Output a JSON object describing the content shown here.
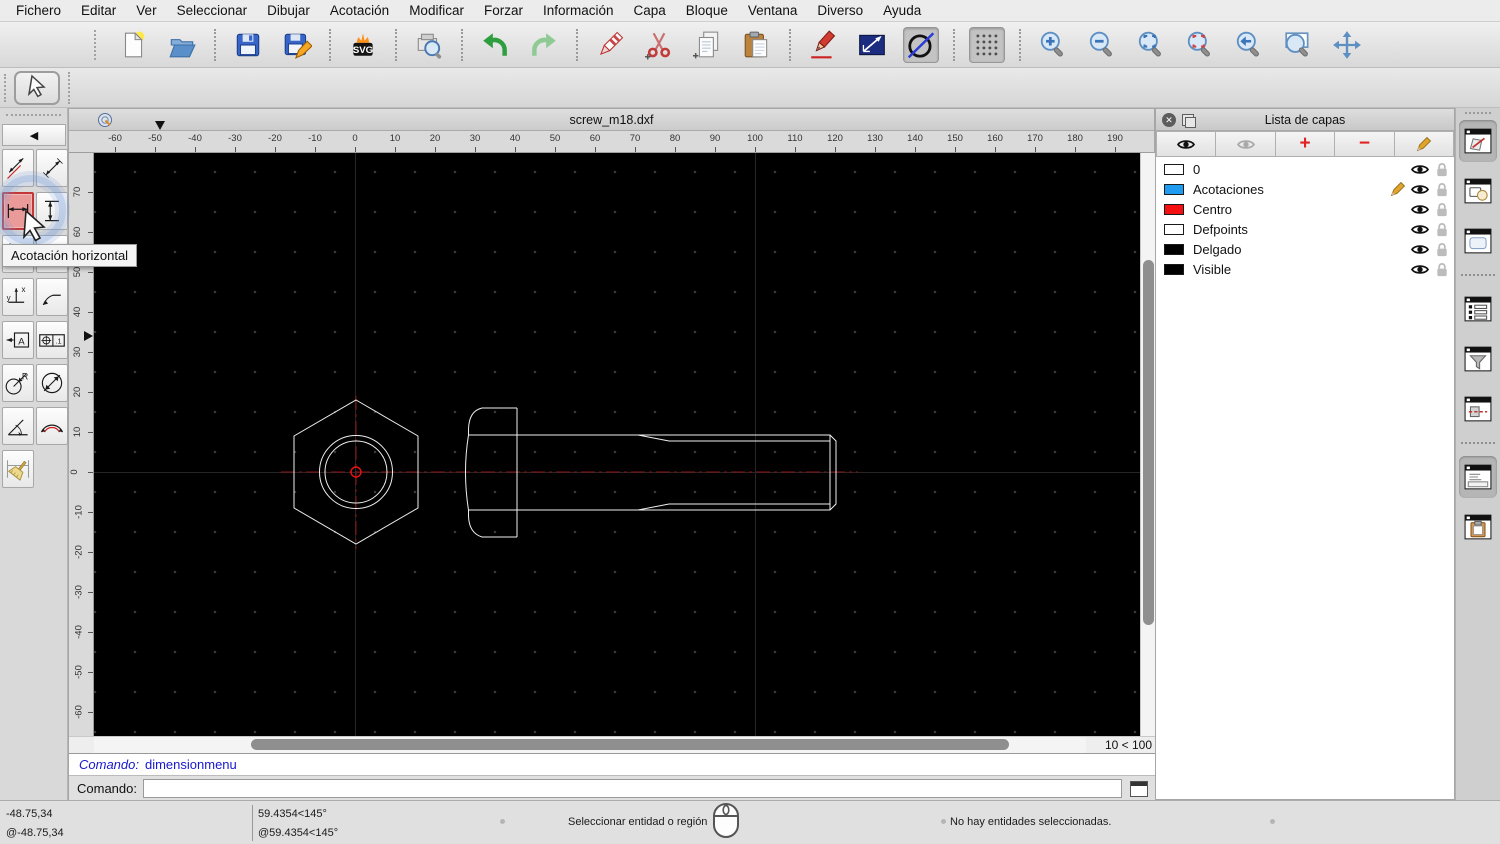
{
  "menu_bar": {
    "items": [
      "Fichero",
      "Editar",
      "Ver",
      "Seleccionar",
      "Dibujar",
      "Acotación",
      "Modificar",
      "Forzar",
      "Información",
      "Capa",
      "Bloque",
      "Ventana",
      "Diverso",
      "Ayuda"
    ]
  },
  "main_toolbar": {
    "svg_badge": "SVG",
    "items": [
      {
        "type": "handle"
      },
      {
        "icon": "new-file"
      },
      {
        "icon": "open-file"
      },
      {
        "type": "sep"
      },
      {
        "icon": "save-file"
      },
      {
        "icon": "save-as"
      },
      {
        "type": "sep"
      },
      {
        "icon": "svg-export"
      },
      {
        "type": "sep"
      },
      {
        "icon": "print-preview"
      },
      {
        "type": "sep"
      },
      {
        "icon": "undo"
      },
      {
        "icon": "redo"
      },
      {
        "type": "sep"
      },
      {
        "icon": "delete-eraser"
      },
      {
        "icon": "cut"
      },
      {
        "icon": "copy"
      },
      {
        "icon": "paste"
      },
      {
        "type": "sep"
      },
      {
        "icon": "draw-pencil"
      },
      {
        "icon": "line-tool"
      },
      {
        "icon": "restrict-nothing",
        "pressed": true
      },
      {
        "type": "sep"
      },
      {
        "icon": "snap-grid",
        "pressed": true
      },
      {
        "type": "sep"
      },
      {
        "icon": "zoom-in"
      },
      {
        "icon": "zoom-out"
      },
      {
        "icon": "zoom-auto"
      },
      {
        "icon": "zoom-redraw"
      },
      {
        "icon": "zoom-previous"
      },
      {
        "icon": "zoom-window"
      },
      {
        "icon": "zoom-pan"
      }
    ]
  },
  "tool_options": {
    "select_tool": "selection-arrow"
  },
  "dimension_palette": {
    "back_glyph": "◀",
    "tooltip": "Acotación horizontal",
    "tools": [
      {
        "name": "dim-aligned"
      },
      {
        "name": "dim-linear"
      },
      {
        "name": "dim-horizontal",
        "hot": true
      },
      {
        "name": "dim-vertical"
      },
      {
        "name": "dim-baseline"
      },
      {
        "name": "dim-continue"
      },
      {
        "name": "dim-ordinate",
        "gx": "x",
        "gy": "y"
      },
      {
        "name": "dim-leader"
      },
      {
        "name": "dim-text",
        "glyph": "A"
      },
      {
        "name": "dim-tolerance",
        "glyph": ".1"
      },
      {
        "name": "dim-radial",
        "glyph": "R"
      },
      {
        "name": "dim-diametric"
      },
      {
        "name": "dim-angular"
      },
      {
        "name": "dim-arc"
      },
      {
        "name": "dim-regenerate"
      }
    ]
  },
  "drawing_window": {
    "title": "screw_m18.dxf",
    "grid_status": "10 < 100",
    "h_ruler_labels": [
      "-60",
      "-50",
      "-40",
      "-30",
      "-20",
      "-10",
      "0",
      "10",
      "20",
      "30",
      "40",
      "50",
      "60",
      "70",
      "80",
      "90",
      "100",
      "110",
      "120",
      "130",
      "140",
      "150",
      "160",
      "170",
      "180",
      "190"
    ],
    "v_ruler_labels": [
      "70",
      "60",
      "50",
      "40",
      "30",
      "20",
      "10",
      "0",
      "-10",
      "-20",
      "-30",
      "-40",
      "-50",
      "-60"
    ]
  },
  "command_panel": {
    "history_prompt": "Comando:",
    "history_command": "dimensionmenu",
    "input_prompt": "Comando:",
    "input_value": ""
  },
  "layers_panel": {
    "title": "Lista de capas",
    "toolbar_icons": [
      "show-all-eye",
      "hide-all-eye",
      "add-layer-plus",
      "remove-layer-minus",
      "edit-layer-pencil"
    ],
    "layers": [
      {
        "name": "0",
        "color": "#ffffff",
        "current": false
      },
      {
        "name": "Acotaciones",
        "color": "#1f9bf0",
        "current": true
      },
      {
        "name": "Centro",
        "color": "#f51111",
        "current": false
      },
      {
        "name": "Defpoints",
        "color": "#ffffff",
        "current": false
      },
      {
        "name": "Delgado",
        "color": "#000000",
        "current": false
      },
      {
        "name": "Visible",
        "color": "#000000",
        "current": false
      }
    ]
  },
  "right_dock": {
    "items": [
      {
        "icon": "layer-list-widget",
        "active": true
      },
      {
        "icon": "block-list-widget"
      },
      {
        "icon": "library-browser-widget"
      },
      {
        "type": "sep"
      },
      {
        "icon": "entity-list-widget"
      },
      {
        "icon": "filter-widget"
      },
      {
        "icon": "demolition-widget"
      },
      {
        "type": "sep"
      },
      {
        "icon": "command-widget",
        "active": true
      },
      {
        "icon": "clipboard-widget"
      }
    ]
  },
  "status_bar": {
    "abs_coords": "-48.75,34",
    "rel_coords": "@-48.75,34",
    "abs_polar": "59.4354<145°",
    "rel_polar": "@59.4354<145°",
    "hint": "Seleccionar entidad o región",
    "selection": "No hay entidades seleccionadas."
  }
}
